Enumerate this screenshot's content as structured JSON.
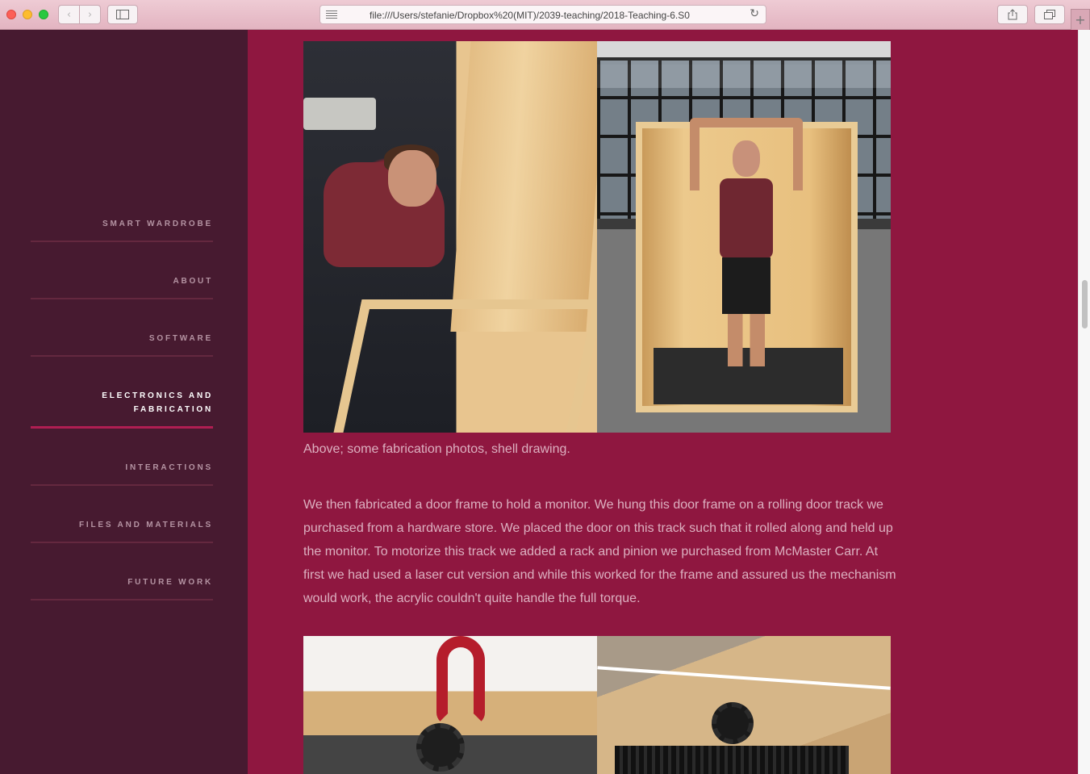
{
  "browser": {
    "url": "file:///Users/stefanie/Dropbox%20(MIT)/2039-teaching/2018-Teaching-6.S0",
    "back_icon": "‹",
    "forward_icon": "›",
    "reload_icon": "↻",
    "new_tab_icon": "+"
  },
  "sidebar": {
    "items": [
      {
        "label": "SMART WARDROBE",
        "active": false
      },
      {
        "label": "ABOUT",
        "active": false
      },
      {
        "label": "SOFTWARE",
        "active": false
      },
      {
        "label": "ELECTRONICS AND FABRICATION",
        "active": true
      },
      {
        "label": "INTERACTIONS",
        "active": false
      },
      {
        "label": "FILES AND MATERIALS",
        "active": false
      },
      {
        "label": "FUTURE WORK",
        "active": false
      }
    ]
  },
  "main": {
    "caption": "Above; some fabrication photos, shell drawing.",
    "paragraph": "We then fabricated a door frame to hold a monitor. We hung this door frame on a rolling door track we purchased from a hardware store. We placed the door on this track such that it rolled along and held up the monitor. To motorize this track we added a rack and pinion we purchased from McMaster Carr. At first we had used a laser cut version and while this worked for the frame and assured us the mechanism would work, the acrylic couldn't quite handle the full torque."
  },
  "colors": {
    "sidebar_bg": "#471a30",
    "main_bg": "#8f1740",
    "active_underline": "#b01e52",
    "text": "#dcb0c0"
  }
}
